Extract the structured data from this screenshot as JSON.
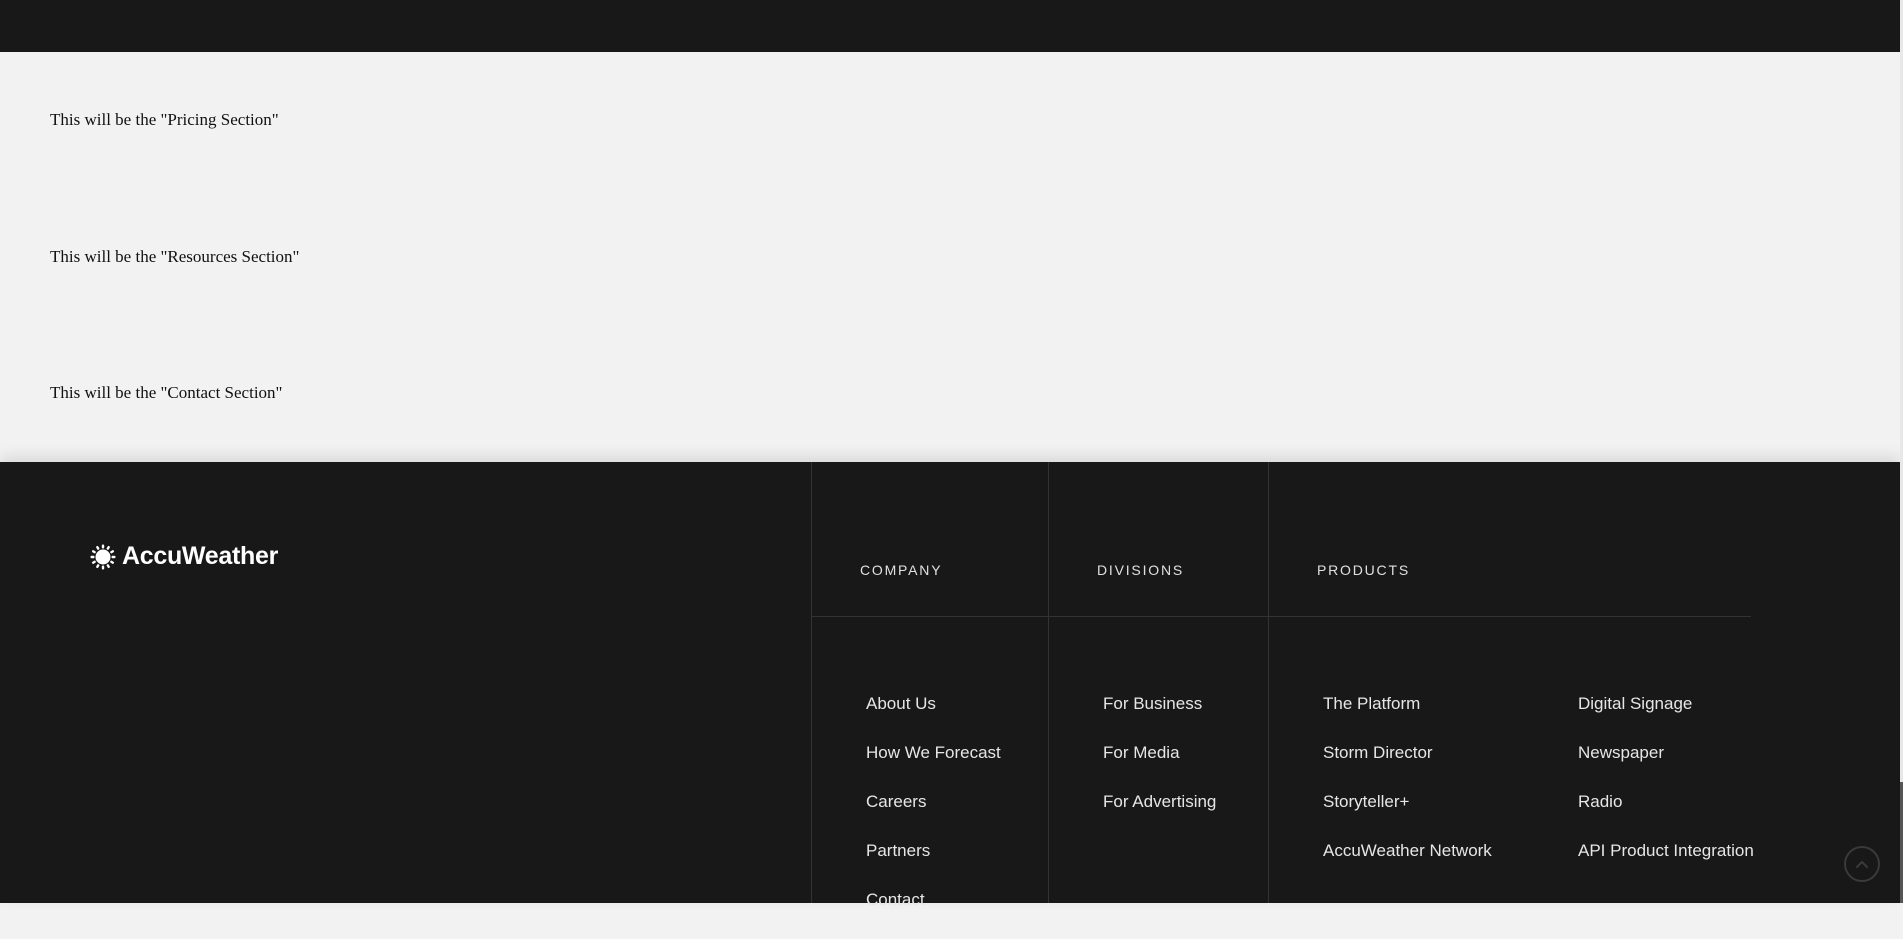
{
  "sections": [
    {
      "text": "This will be the \"Pricing Section\""
    },
    {
      "text": "This will be the \"Resources Section\""
    },
    {
      "text": "This will be the \"Contact Section\""
    }
  ],
  "footer": {
    "logo": {
      "text": "AccuWeather",
      "icon": "sun-icon"
    },
    "columns": [
      {
        "heading": "COMPANY",
        "links": [
          "About Us",
          "How We Forecast",
          "Careers",
          "Partners",
          "Contact"
        ]
      },
      {
        "heading": "DIVISIONS",
        "links": [
          "For Business",
          "For Media",
          "For Advertising"
        ]
      },
      {
        "heading": "PRODUCTS",
        "links": [
          "The Platform",
          "Storm Director",
          "Storyteller+",
          "AccuWeather Network"
        ]
      },
      {
        "heading": "",
        "links": [
          "Digital Signage",
          "Newspaper",
          "Radio",
          "API Product Integration"
        ]
      }
    ],
    "scroll_top_icon": "chevron-up-icon"
  },
  "colors": {
    "dark_background": "#181818",
    "page_background": "#f2f2f2",
    "divider": "#333333",
    "footer_text": "#e6e6e6"
  }
}
